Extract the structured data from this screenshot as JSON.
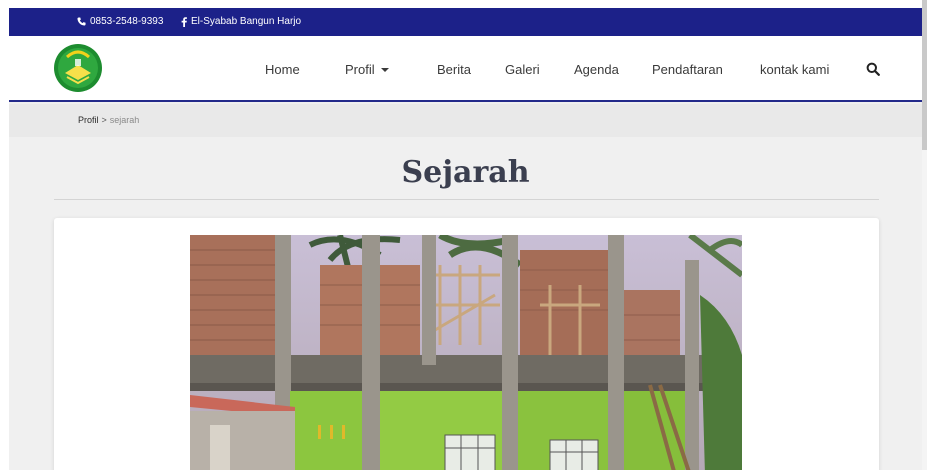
{
  "topbar": {
    "phone": "0853-2548-9393",
    "facebook": "El-Syabab Bangun Harjo",
    "bg_color": "#1c2189"
  },
  "nav": {
    "items": [
      "Home",
      "Profil",
      "Berita",
      "Galeri",
      "Agenda",
      "Pendaftaran",
      "kontak kami"
    ],
    "accent_color": "#232a8a"
  },
  "breadcrumb": {
    "parent": "Profil",
    "separator": ">",
    "current": "sejarah"
  },
  "page": {
    "title": "Sejarah"
  },
  "icons": {
    "phone": "phone-icon",
    "facebook": "facebook-icon",
    "search": "search-icon",
    "dropdown": "caret-down-icon"
  }
}
